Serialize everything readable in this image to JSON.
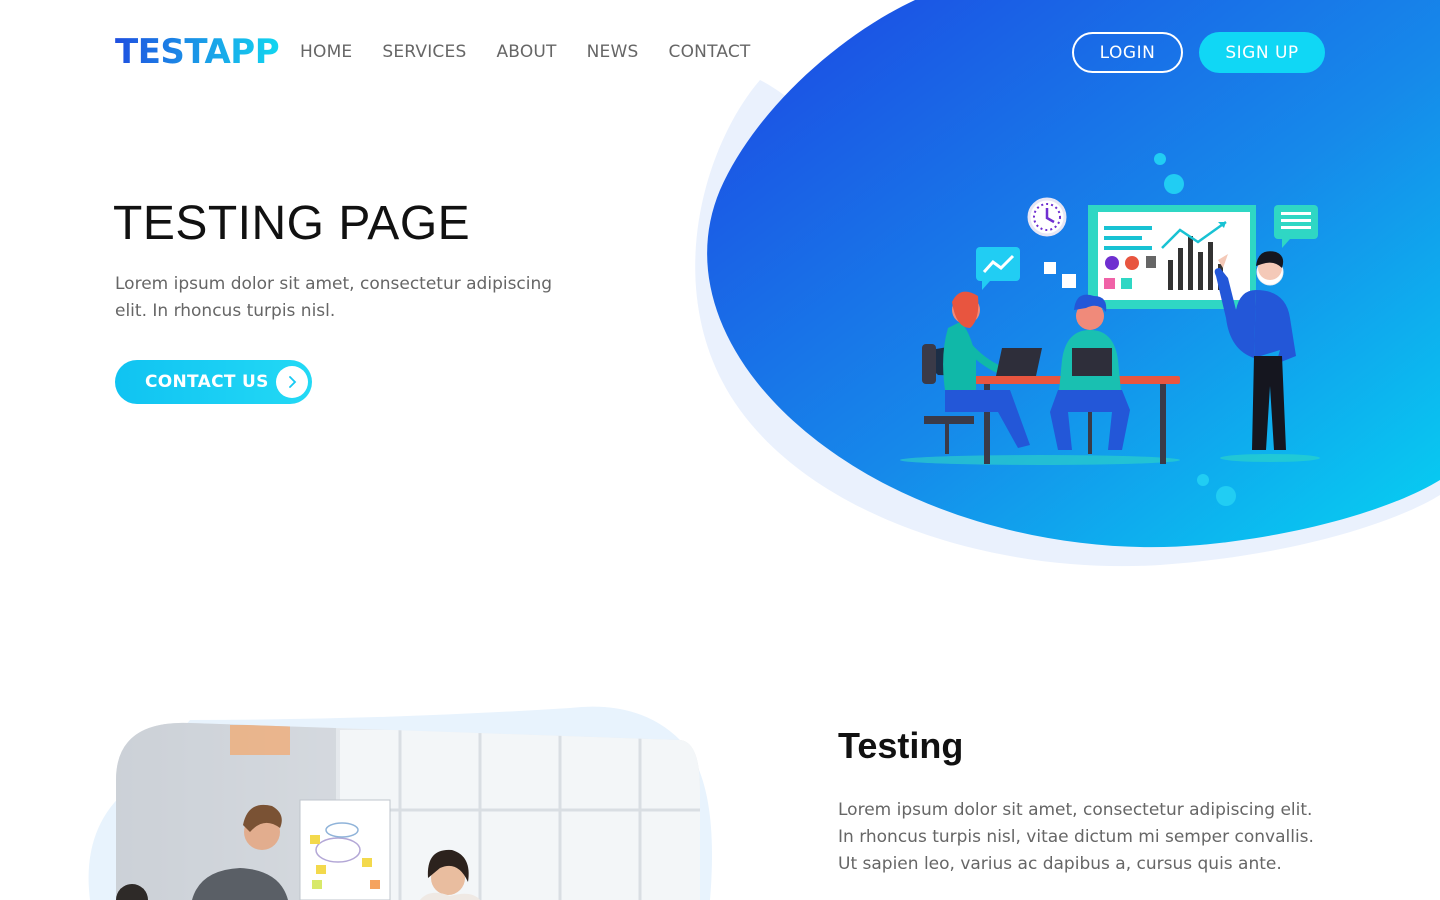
{
  "header": {
    "logo": "TESTAPP",
    "nav": [
      "HOME",
      "SERVICES",
      "ABOUT",
      "NEWS",
      "CONTACT"
    ],
    "login_label": "LOGIN",
    "signup_label": "SIGN UP"
  },
  "hero": {
    "title": "TESTING PAGE",
    "description": "Lorem ipsum dolor sit amet, consectetur adipiscing elit. In rhoncus turpis nisl.",
    "cta_label": "CONTACT US"
  },
  "section2": {
    "title": "Testing",
    "description": "Lorem ipsum dolor sit amet, consectetur adipiscing elit. In rhoncus turpis nisl, vitae dictum mi semper convallis. Ut sapien leo, varius ac dapibus a, cursus quis ante."
  },
  "colors": {
    "brand_dark": "#1f4fe0",
    "brand_light": "#12d6f0",
    "signup_bg": "#10d7f5",
    "text_muted": "#666666"
  },
  "icons": [
    "chevron-right-icon",
    "clock-icon",
    "trend-chat-icon",
    "message-icon",
    "dashboard-board-icon"
  ]
}
